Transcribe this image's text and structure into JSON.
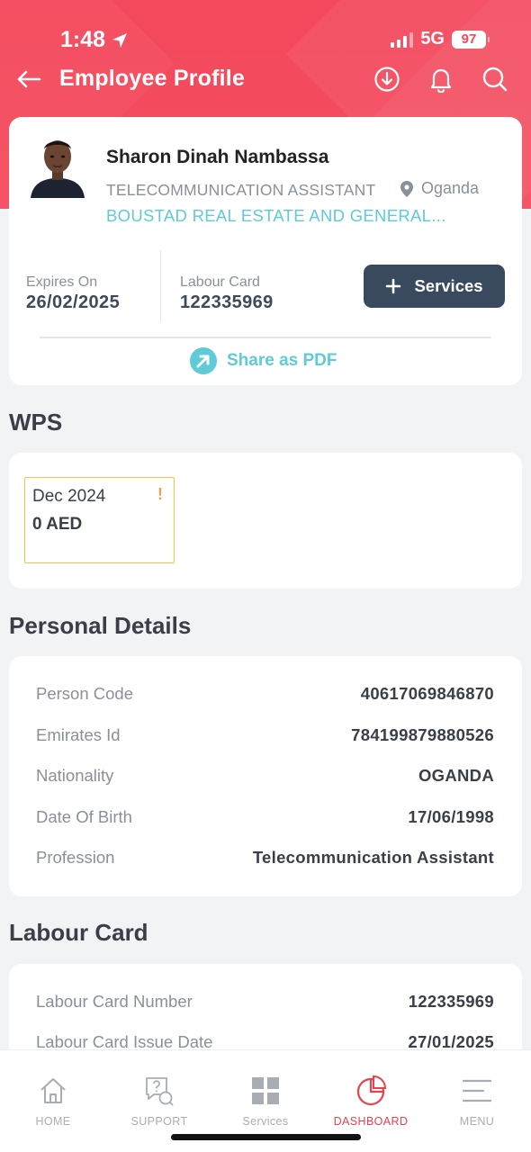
{
  "status_bar": {
    "time": "1:48",
    "network": "5G",
    "battery": "97"
  },
  "app_bar": {
    "title": "Employee Profile"
  },
  "profile": {
    "name": "Sharon Dinah Nambassa",
    "role": "TELECOMMUNICATION ASSISTANT",
    "location": "Oganda",
    "company": "BOUSTAD REAL ESTATE AND GENERAL...",
    "expires_label": "Expires On",
    "expires_value": "26/02/2025",
    "labour_card_label": "Labour Card",
    "labour_card_value": "122335969",
    "services_label": "Services",
    "share_label": "Share as PDF"
  },
  "wps": {
    "title": "WPS",
    "items": [
      {
        "month": "Dec 2024",
        "amount": "0 AED",
        "warning": "!"
      }
    ]
  },
  "personal_details": {
    "title": "Personal Details",
    "rows": [
      {
        "label": "Person Code",
        "value": "40617069846870"
      },
      {
        "label": "Emirates Id",
        "value": "784199879880526"
      },
      {
        "label": "Nationality",
        "value": "OGANDA"
      },
      {
        "label": "Date Of Birth",
        "value": "17/06/1998"
      },
      {
        "label": "Profession",
        "value": "Telecommunication Assistant"
      }
    ]
  },
  "labour_card": {
    "title": "Labour Card",
    "rows": [
      {
        "label": "Labour Card Number",
        "value": "122335969"
      },
      {
        "label": "Labour Card Issue Date",
        "value": "27/01/2025"
      }
    ]
  },
  "tabs": [
    {
      "label": "HOME",
      "icon": "home-icon"
    },
    {
      "label": "SUPPORT",
      "icon": "support-icon"
    },
    {
      "label": "Services",
      "icon": "grid-icon"
    },
    {
      "label": "DASHBOARD",
      "icon": "pie-chart-icon",
      "active": true
    },
    {
      "label": "MENU",
      "icon": "menu-icon"
    }
  ],
  "colors": {
    "header": "#f4485c",
    "accent": "#5ecbd6",
    "button": "#3a4a5e",
    "active_tab": "#e8424e",
    "warning_border": "#f2c24a"
  }
}
